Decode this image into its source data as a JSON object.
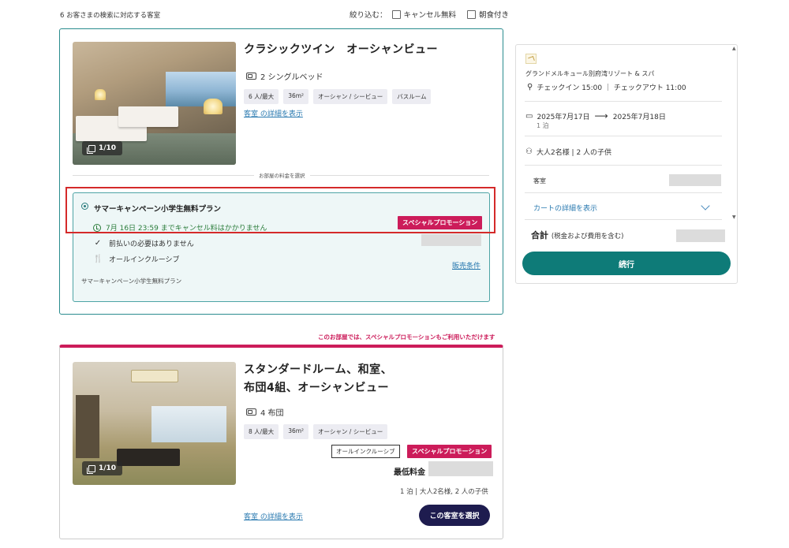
{
  "search": {
    "result_count_text": "6 お客さまの検索に対応する客室",
    "filter_label": "絞り込む：",
    "filters": [
      {
        "label": "キャンセル無料",
        "checked": false
      },
      {
        "label": "朝食付き",
        "checked": false
      }
    ]
  },
  "room1": {
    "title": "クラシックツイン　オーシャンビュー",
    "photo_counter": "1/10",
    "bed": "2 シングルベッド",
    "tags": [
      "6 人/最大",
      "36m²",
      "オーシャン / シービュー",
      "バスルーム"
    ],
    "details_link": "客室 の詳細を表示",
    "rate_divider_label": "お部屋の料金を選択",
    "plan": {
      "name": "サマーキャンペーン小学生無料プラン",
      "promo_badge": "スペシャルプロモーション",
      "cancellation": "7月 16日 23:59 までキャンセル料はかかりません",
      "prepay": "前払いの必要はありません",
      "meal": "オールインクルーシブ",
      "sales_terms_link": "販売条件",
      "description": "サマーキャンペーン小学生無料プラン",
      "selected": true
    }
  },
  "room2": {
    "promo_banner": "このお部屋では、スペシャルプロモーションもご利用いただけます",
    "title_line1": "スタンダードルーム、和室、",
    "title_line2": "布団4組、オーシャンビュー",
    "photo_counter": "1/10",
    "bed": "4 布団",
    "tags": [
      "8 人/最大",
      "36m²",
      "オーシャン / シービュー"
    ],
    "meal_tag": "オールインクルーシブ",
    "promo_badge": "スペシャルプロモーション",
    "min_price_label": "最低料金",
    "stay_summary": "1 泊 | 大人2名様, 2 人の子供",
    "details_link": "客室 の詳細を表示",
    "select_button": "この客室を選択"
  },
  "sidebar": {
    "hotel_name": "グランドメルキュール別府湾リゾート & スパ",
    "checkin_checkout": "チェックイン 15:00 ｜ チェックアウト 11:00",
    "date_from": "2025年7月17日",
    "date_to": "2025年7月18日",
    "nights": "1 泊",
    "guests": "大人2名様 | 2 人の子供",
    "room_label": "客室",
    "cart_details_link": "カートの詳細を表示",
    "total_label": "合計",
    "total_note": "(税金および費用を含む)",
    "continue_button": "続行"
  },
  "colors": {
    "accent_teal": "#0e7b78",
    "promo_pink": "#cc1c5a",
    "select_navy": "#1e1c4f",
    "highlight_red": "#d42a2a"
  }
}
